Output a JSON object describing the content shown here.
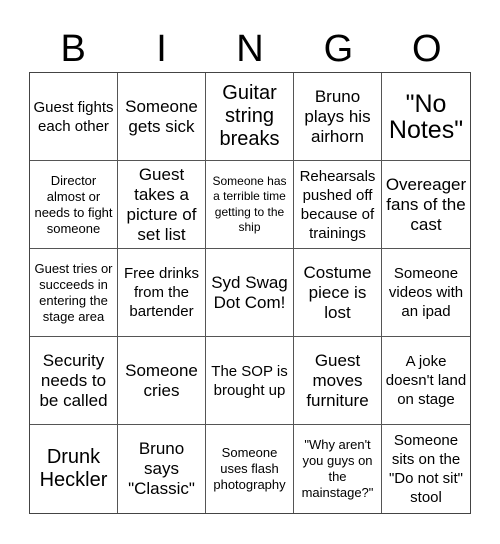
{
  "header": {
    "letters": [
      "B",
      "I",
      "N",
      "G",
      "O"
    ]
  },
  "cells": [
    [
      "Guest fights each other",
      "Someone gets sick",
      "Guitar string breaks",
      "Bruno plays his airhorn",
      "\"No Notes\""
    ],
    [
      "Director almost or needs to fight someone",
      "Guest takes a picture of set list",
      "Someone has a terrible time getting to the ship",
      "Rehearsals pushed off because of trainings",
      "Overeager fans of the cast"
    ],
    [
      "Guest tries or succeeds in entering the stage area",
      "Free drinks from the bartender",
      "Syd Swag Dot Com!",
      "Costume piece is lost",
      "Someone videos with an ipad"
    ],
    [
      "Security needs to be called",
      "Someone cries",
      "The SOP is brought up",
      "Guest moves furniture",
      "A joke doesn't land on stage"
    ],
    [
      "Drunk Heckler",
      "Bruno says \"Classic\"",
      "Someone uses flash photography",
      "\"Why aren't you guys on the mainstage?\"",
      "Someone sits on the \"Do not sit\" stool"
    ]
  ]
}
